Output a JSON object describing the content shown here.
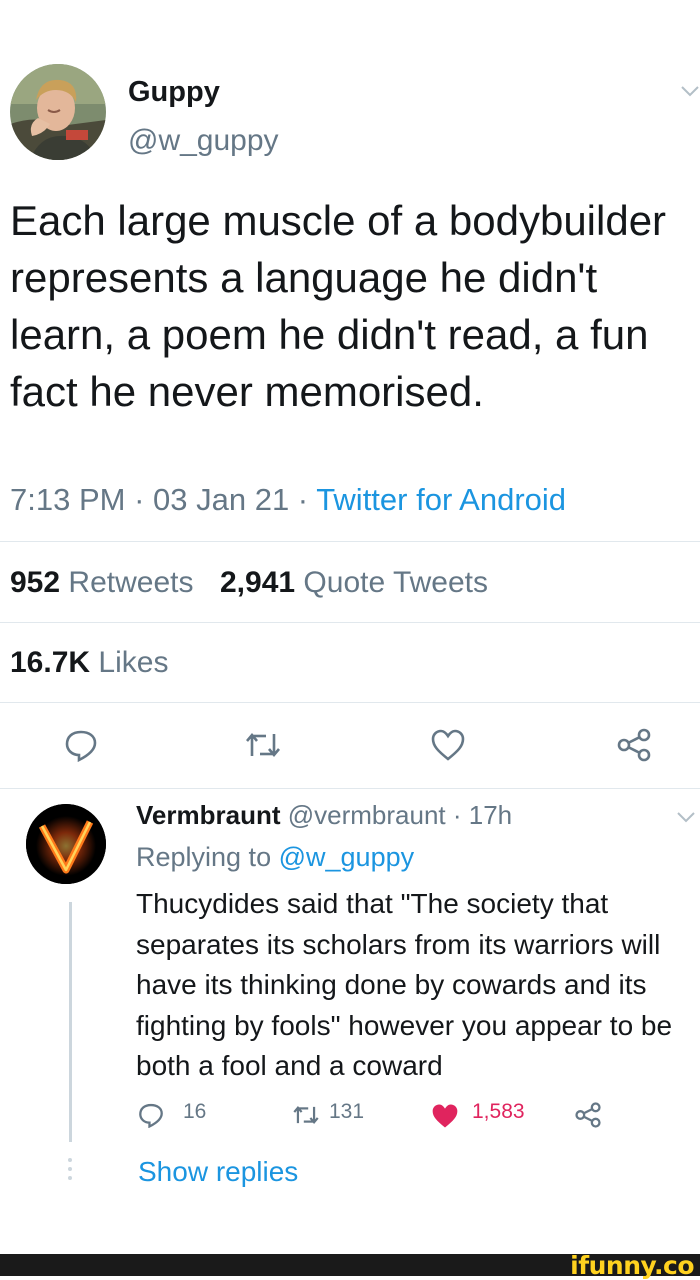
{
  "tweet": {
    "author_name": "Guppy",
    "author_handle": "@w_guppy",
    "text": "Each large muscle of a bodybuilder represents a language he didn't learn, a poem he didn't read, a fun fact he never memorised.",
    "time": "7:13 PM",
    "date": "03 Jan 21",
    "separator": " · ",
    "source": "Twitter for Android",
    "retweets_count": "952",
    "retweets_label": "Retweets",
    "quotes_count": "2,941",
    "quotes_label": "Quote Tweets",
    "likes_count": "16.7K",
    "likes_label": "Likes",
    "actions": [
      "reply-icon",
      "retweet-icon",
      "like-icon",
      "share-icon"
    ]
  },
  "reply": {
    "author_name": "Vermbraunt",
    "author_handle": "@vermbraunt",
    "time_ago": "17h",
    "replying_prefix": "Replying to",
    "replying_to": "@w_guppy",
    "text": "Thucydides said that \"The society that separates its scholars from its warriors will have its thinking done by cowards and its fighting by fools\" however you appear to be both a fool and a coward",
    "reply_count": "16",
    "retweet_count": "131",
    "like_count": "1,583",
    "liked": true,
    "show_replies": "Show replies"
  },
  "colors": {
    "link": "#1b95e0",
    "secondary": "#657786",
    "liked": "#e0245e",
    "divider": "#e1e8ed"
  },
  "watermark": "ifunny.co"
}
